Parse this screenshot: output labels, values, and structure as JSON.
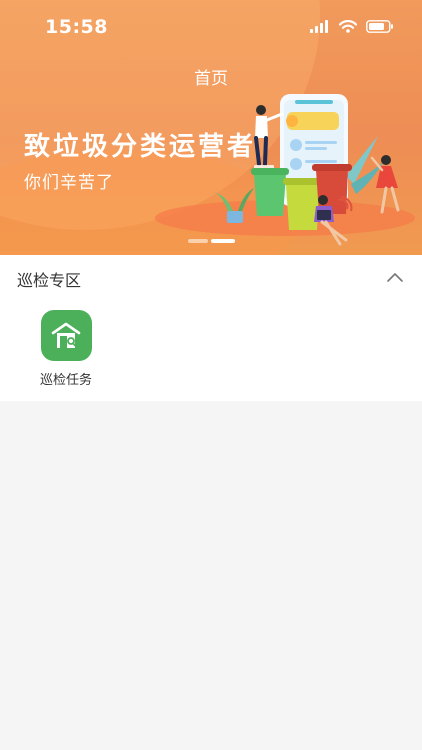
{
  "status_bar": {
    "time": "15:58",
    "icons": [
      "signal-icon",
      "wifi-icon",
      "battery-icon"
    ]
  },
  "banner": {
    "nav_title": "首页",
    "headline": "致垃圾分类运营者",
    "subline": "你们辛苦了",
    "carousel": {
      "count": 2,
      "active_index": 1
    }
  },
  "section": {
    "title": "巡检专区",
    "collapse_icon": "chevron-up-icon",
    "items": [
      {
        "label": "巡检任务",
        "icon": "patrol-house-search-icon",
        "color": "#4caf5a"
      }
    ]
  },
  "colors": {
    "banner_orange": "#ee8d55",
    "accent_green": "#4caf5a",
    "page_background": "#f5f5f5"
  }
}
